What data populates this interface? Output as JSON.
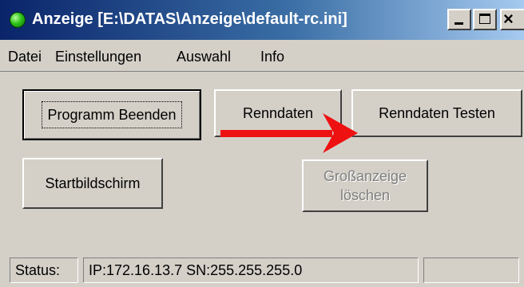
{
  "window": {
    "title": "Anzeige [E:\\DATAS\\Anzeige\\default-rc.ini]",
    "app_icon": "green-status-light-icon",
    "controls": [
      "minimize-icon",
      "maximize-icon",
      "close-icon"
    ],
    "close_glyph": "×"
  },
  "menu": {
    "items": [
      {
        "label": "Datei"
      },
      {
        "label": "Einstellungen"
      },
      {
        "label": "Auswahl"
      },
      {
        "label": "Info"
      }
    ]
  },
  "buttons": {
    "quit": "Programm Beenden",
    "race_data": "Renndaten",
    "race_data_test": "Renndaten Testen",
    "start_screen": "Startbildschirm",
    "clear_big_display_line1": "Großanzeige",
    "clear_big_display_line2": "löschen"
  },
  "annotation": {
    "arrow_color": "#ee1111",
    "points_to": "Renndaten Testen"
  },
  "status": {
    "label": "Status:",
    "text": "IP:172.16.13.7 SN:255.255.255.0",
    "extra": ""
  },
  "colors": {
    "title_start": "#0a246a",
    "title_end": "#a6caf0",
    "face": "#d4d0c8",
    "disabled_text": "#808080"
  }
}
